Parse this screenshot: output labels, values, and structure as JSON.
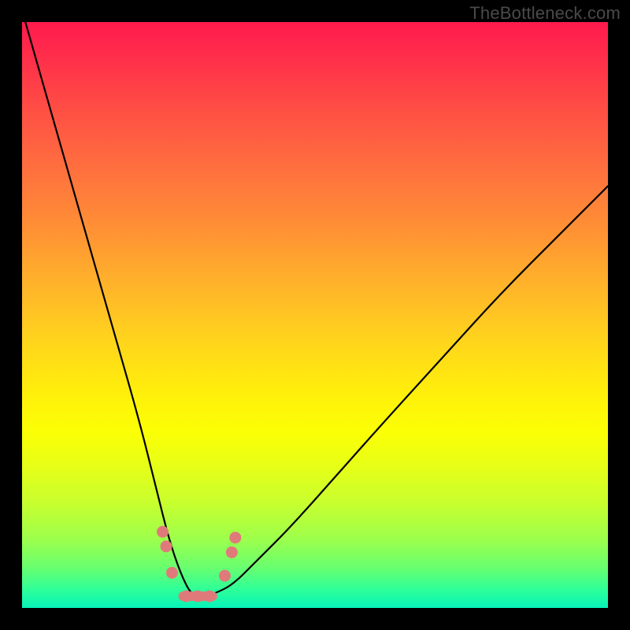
{
  "watermark": "TheBottleneck.com",
  "colors": {
    "page_bg": "#000000",
    "gradient_top": "#ff1a4d",
    "gradient_bottom": "#07f2b8",
    "curve": "#000000",
    "marker": "#e07a7a"
  },
  "chart_data": {
    "type": "line",
    "title": "",
    "subtitle": "",
    "xlabel": "",
    "ylabel": "",
    "xlim": [
      0,
      100
    ],
    "ylim": [
      0,
      100
    ],
    "grid": false,
    "legend": false,
    "series": [
      {
        "name": "bottleneck-curve",
        "x": [
          0,
          4,
          8,
          12,
          16,
          20,
          23,
          25,
          27,
          29,
          31,
          33,
          36,
          40,
          46,
          54,
          62,
          72,
          82,
          92,
          100
        ],
        "y": [
          102,
          88,
          74,
          60,
          46,
          32,
          20,
          12,
          6,
          2,
          2,
          2.5,
          4,
          8,
          14,
          23,
          32,
          43,
          54,
          64,
          72
        ]
      }
    ],
    "markers": [
      {
        "x": 24.0,
        "y": 13.0
      },
      {
        "x": 24.6,
        "y": 10.5
      },
      {
        "x": 25.6,
        "y": 6.0
      },
      {
        "x": 28.0,
        "y": 2.0
      },
      {
        "x": 30.0,
        "y": 2.0
      },
      {
        "x": 32.0,
        "y": 2.0
      },
      {
        "x": 34.6,
        "y": 5.5
      },
      {
        "x": 35.8,
        "y": 9.5
      },
      {
        "x": 36.4,
        "y": 12.0
      }
    ],
    "trough_segment": {
      "x0": 27.5,
      "y0": 2.0,
      "x1": 32.5,
      "y1": 2.0
    }
  }
}
